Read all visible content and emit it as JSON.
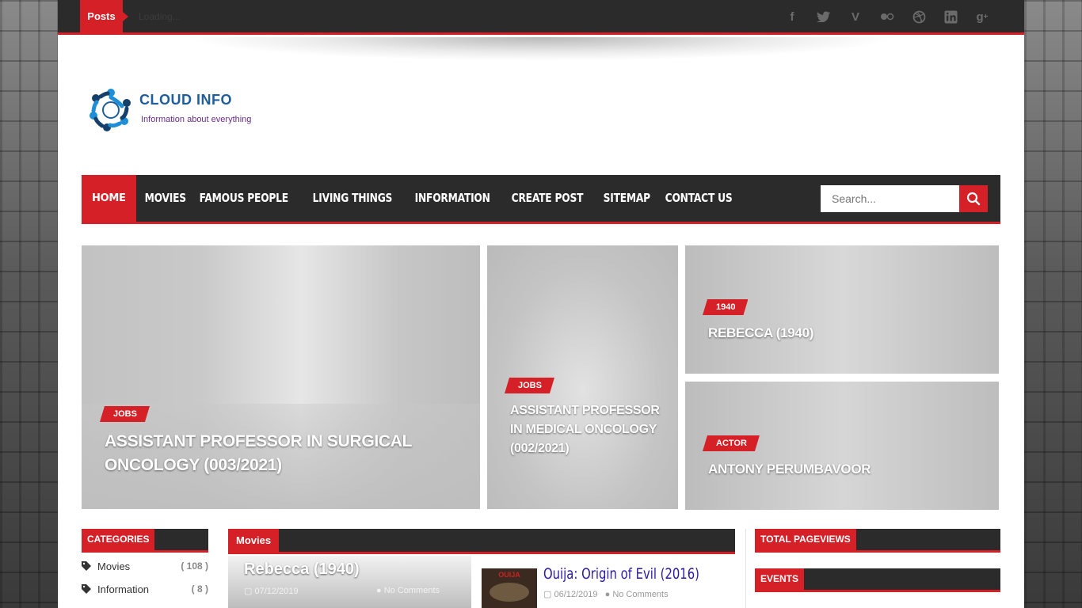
{
  "topbar": {
    "ticker_label": "Posts",
    "ticker_text": "Loading...",
    "socials": [
      "facebook-icon",
      "twitter-icon",
      "vimeo-icon",
      "flickr-icon",
      "dribbble-icon",
      "linkedin-icon",
      "google-plus-icon"
    ]
  },
  "logo": {
    "title": "CLOUD INFO",
    "tagline": "Information about everything"
  },
  "nav": {
    "items": [
      "HOME",
      "MOVIES",
      "FAMOUS PEOPLE",
      "LIVING THINGS",
      "INFORMATION",
      "CREATE POST",
      "SITEMAP",
      "CONTACT US"
    ],
    "search_placeholder": "Search..."
  },
  "featured": [
    {
      "tag": "JOBS",
      "title": "ASSISTANT PROFESSOR IN SURGICAL ONCOLOGY (003/2021)"
    },
    {
      "tag": "JOBS",
      "title": "ASSISTANT PROFESSOR IN MEDICAL ONCOLOGY (002/2021)"
    },
    {
      "tag": "1940",
      "title": "REBECCA (1940)"
    },
    {
      "tag": "ACTOR",
      "title": "ANTONY PERUMBAVOOR"
    }
  ],
  "categories": {
    "heading": "CATEGORIES",
    "items": [
      {
        "name": "Movies",
        "count": "( 108 )"
      },
      {
        "name": "Information",
        "count": "( 8 )"
      }
    ]
  },
  "movies": {
    "heading": "Movies",
    "big_post": {
      "title": "Rebecca (1940)",
      "date": "07/12/2019",
      "comments": "No Comments"
    },
    "small_post": {
      "title": "Ouija: Origin of Evil (2016)",
      "date": "06/12/2019",
      "comments": "No Comments",
      "thumb_text": "OUIJA"
    }
  },
  "widgets": {
    "pageviews": "TOTAL PAGEVIEWS",
    "events": "EVENTS"
  },
  "colors": {
    "accent": "#d42026",
    "dark": "#2b2b2b"
  }
}
